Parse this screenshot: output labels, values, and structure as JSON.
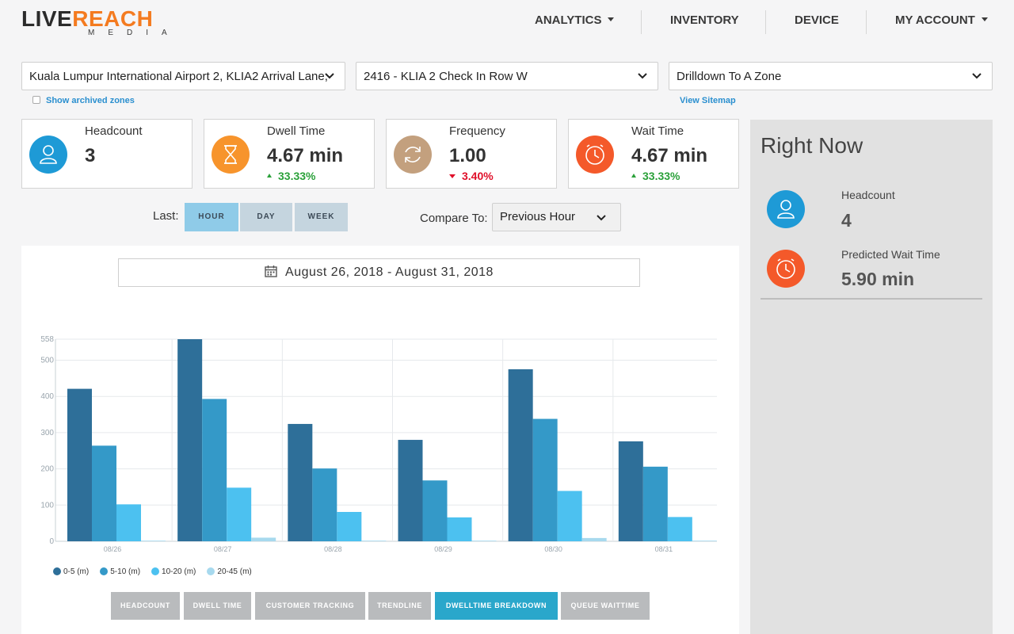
{
  "logo": {
    "part1": "LIVE",
    "part2": "REACH",
    "sub": "MEDIA"
  },
  "nav": {
    "analytics": "ANALYTICS",
    "inventory": "INVENTORY",
    "device": "DEVICE",
    "account": "MY ACCOUNT"
  },
  "filters": {
    "location": "Kuala Lumpur International Airport 2, KLIA2 Arrival Lane,",
    "zone": "2416 - KLIA 2 Check In Row W",
    "drilldown": "Drilldown To A Zone",
    "show_archived": "Show archived zones",
    "view_sitemap": "View Sitemap"
  },
  "stats": [
    {
      "label": "Headcount",
      "value": "3",
      "delta": "",
      "icon": "user-icon",
      "color": "#1e9ad6"
    },
    {
      "label": "Dwell Time",
      "value": "4.67 min",
      "delta": "33.33%",
      "direction": "up",
      "icon": "hourglass-icon",
      "color": "#f7942c"
    },
    {
      "label": "Frequency",
      "value": "1.00",
      "delta": "3.40%",
      "direction": "down",
      "icon": "refresh-icon",
      "color": "#c3a07e"
    },
    {
      "label": "Wait Time",
      "value": "4.67 min",
      "delta": "33.33%",
      "direction": "up",
      "icon": "clock-icon",
      "color": "#f4592a"
    }
  ],
  "controls": {
    "last_label": "Last:",
    "periods": [
      "HOUR",
      "DAY",
      "WEEK"
    ],
    "active_period": "HOUR",
    "compare_label": "Compare To:",
    "compare_value": "Previous Hour"
  },
  "right_now": {
    "title": "Right Now",
    "headcount_label": "Headcount",
    "headcount_value": "4",
    "wait_label": "Predicted Wait Time",
    "wait_value": "5.90 min"
  },
  "date_range": "August 26, 2018 - August 31, 2018",
  "colors": {
    "accent_orange": "#f47b20",
    "tab_active": "#2aa7cb",
    "tab_inactive": "#b9bbbd"
  },
  "chart_data": {
    "type": "bar",
    "categories": [
      "08/26",
      "08/27",
      "08/28",
      "08/29",
      "08/30",
      "08/31"
    ],
    "series": [
      {
        "name": "0-5 (m)",
        "color": "#2e6f99",
        "values": [
          421,
          558,
          324,
          280,
          475,
          276
        ]
      },
      {
        "name": "5-10 (m)",
        "color": "#3499c8",
        "values": [
          264,
          393,
          201,
          168,
          338,
          206
        ]
      },
      {
        "name": "10-20 (m)",
        "color": "#4cc1f0",
        "values": [
          102,
          148,
          81,
          66,
          139,
          67
        ]
      },
      {
        "name": "20-45 (m)",
        "color": "#a7d9ee",
        "values": [
          0,
          10,
          0,
          0,
          9,
          0
        ]
      }
    ],
    "yticks": [
      0,
      100,
      200,
      300,
      400,
      500,
      558
    ],
    "ylim": [
      0,
      558
    ],
    "grid": true,
    "legend": "bottom-left"
  },
  "tabs": [
    "HEADCOUNT",
    "DWELL TIME",
    "CUSTOMER TRACKING",
    "TRENDLINE",
    "DWELLTIME BREAKDOWN",
    "QUEUE WAITTIME"
  ],
  "active_tab": "DWELLTIME BREAKDOWN"
}
